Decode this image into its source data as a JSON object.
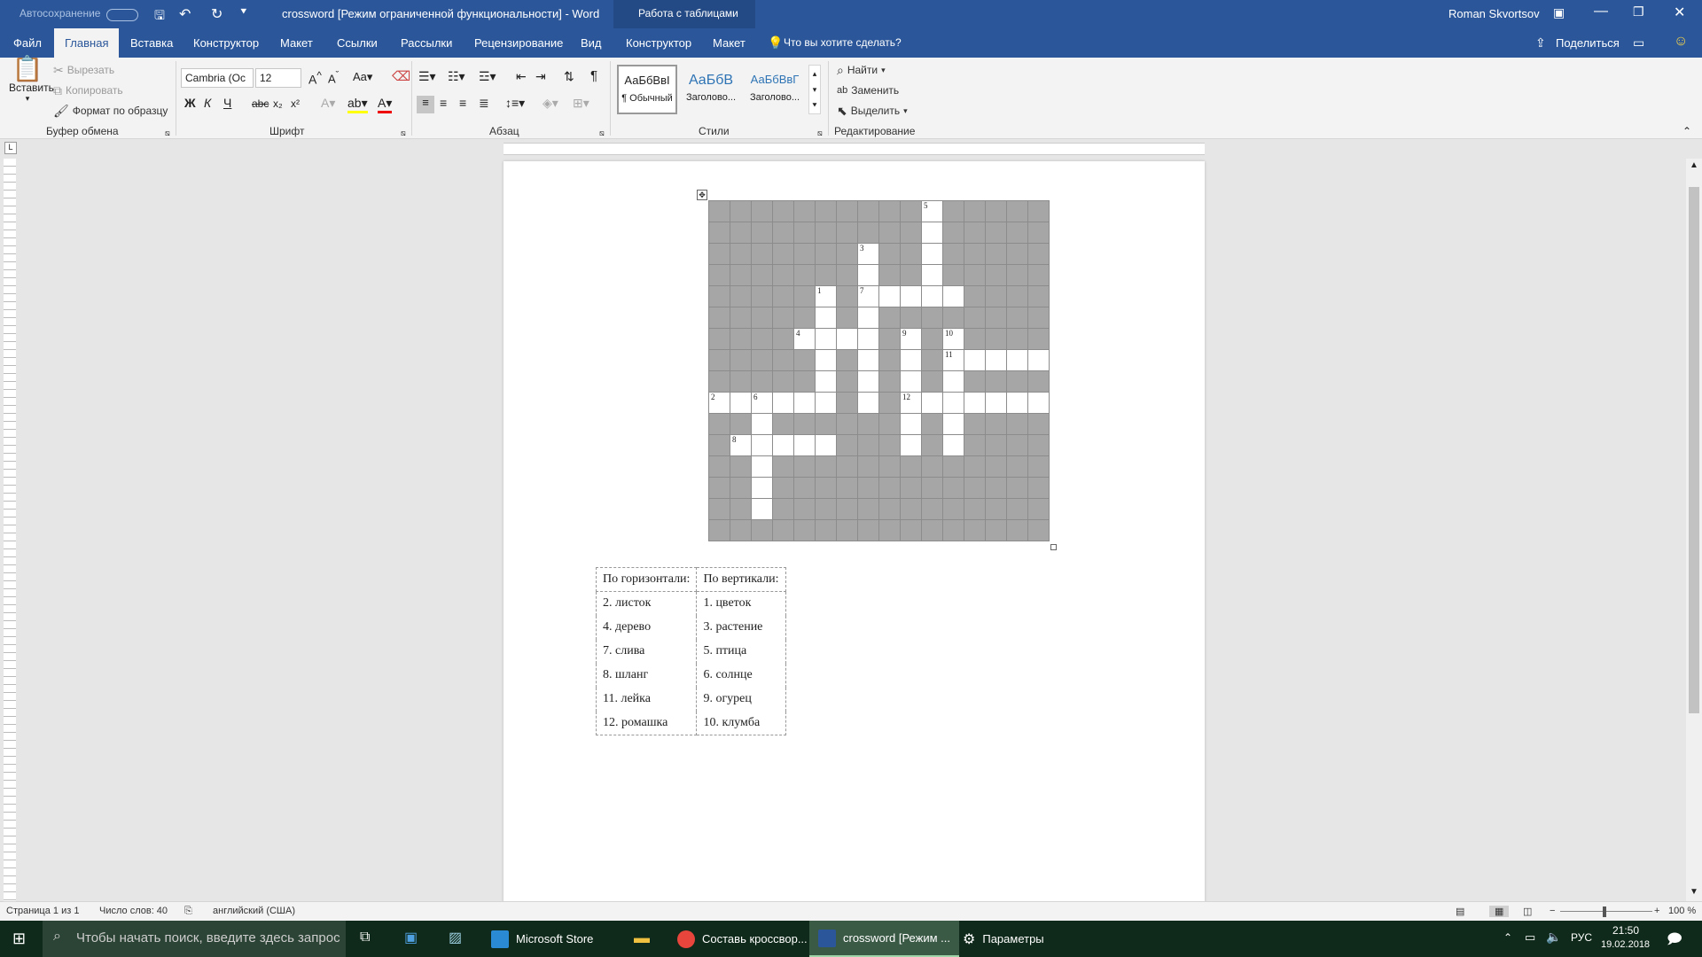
{
  "titlebar": {
    "autosave": "Автосохранение",
    "title": "crossword [Режим ограниченной функциональности]  -  Word",
    "context": "Работа с таблицами",
    "user": "Roman Skvortsov"
  },
  "tabs": [
    "Файл",
    "Главная",
    "Вставка",
    "Конструктор",
    "Макет",
    "Ссылки",
    "Рассылки",
    "Рецензирование",
    "Вид",
    "Конструктор",
    "Макет"
  ],
  "tell_me": "Что вы хотите сделать?",
  "share": "Поделиться",
  "ribbon": {
    "clipboard": {
      "paste": "Вставить",
      "cut": "Вырезать",
      "copy": "Копировать",
      "format_painter": "Формат по образцу",
      "label": "Буфер обмена"
    },
    "font": {
      "name": "Cambria (Ос",
      "size": "12",
      "label": "Шрифт",
      "bold": "Ж",
      "italic": "К",
      "underline": "Ч"
    },
    "paragraph": {
      "label": "Абзац"
    },
    "styles": {
      "label": "Стили",
      "items": [
        {
          "preview": "АаБбВвІ",
          "name": "¶ Обычный"
        },
        {
          "preview": "АаБбВ",
          "name": "Заголово..."
        },
        {
          "preview": "АаБбВвГ",
          "name": "Заголово..."
        }
      ]
    },
    "editing": {
      "find": "Найти",
      "replace": "Заменить",
      "select": "Выделить",
      "label": "Редактирование"
    }
  },
  "crossword": {
    "rows": [
      [
        "b",
        "b",
        "b",
        "b",
        "b",
        "b",
        "b",
        "b",
        "b",
        "b",
        "w:5",
        "b",
        "b",
        "b",
        "b",
        "b"
      ],
      [
        "b",
        "b",
        "b",
        "b",
        "b",
        "b",
        "b",
        "b",
        "b",
        "b",
        "w",
        "b",
        "b",
        "b",
        "b",
        "b"
      ],
      [
        "b",
        "b",
        "b",
        "b",
        "b",
        "b",
        "b",
        "w:3",
        "b",
        "b",
        "w",
        "b",
        "b",
        "b",
        "b",
        "b"
      ],
      [
        "b",
        "b",
        "b",
        "b",
        "b",
        "b",
        "b",
        "w",
        "b",
        "b",
        "w",
        "b",
        "b",
        "b",
        "b",
        "b"
      ],
      [
        "b",
        "b",
        "b",
        "b",
        "b",
        "w:1",
        "b",
        "w:7",
        "w",
        "w",
        "w",
        "w",
        "b",
        "b",
        "b",
        "b"
      ],
      [
        "b",
        "b",
        "b",
        "b",
        "b",
        "w",
        "b",
        "w",
        "b",
        "b",
        "b",
        "b",
        "b",
        "b",
        "b",
        "b"
      ],
      [
        "b",
        "b",
        "b",
        "b",
        "w:4",
        "w",
        "w",
        "w",
        "b",
        "w:9",
        "b",
        "w:10",
        "b",
        "b",
        "b",
        "b"
      ],
      [
        "b",
        "b",
        "b",
        "b",
        "b",
        "w",
        "b",
        "w",
        "b",
        "w",
        "b",
        "w:11",
        "w",
        "w",
        "w",
        "w"
      ],
      [
        "b",
        "b",
        "b",
        "b",
        "b",
        "w",
        "b",
        "w",
        "b",
        "w",
        "b",
        "w",
        "b",
        "b",
        "b",
        "b"
      ],
      [
        "w:2",
        "w",
        "w:6",
        "w",
        "w",
        "w",
        "b",
        "w",
        "b",
        "w:12",
        "w",
        "w",
        "w",
        "w",
        "w",
        "w"
      ],
      [
        "b",
        "b",
        "w",
        "b",
        "b",
        "b",
        "b",
        "b",
        "b",
        "w",
        "b",
        "w",
        "b",
        "b",
        "b",
        "b"
      ],
      [
        "b",
        "w:8",
        "w",
        "w",
        "w",
        "w",
        "b",
        "b",
        "b",
        "w",
        "b",
        "w",
        "b",
        "b",
        "b",
        "b"
      ],
      [
        "b",
        "b",
        "w",
        "b",
        "b",
        "b",
        "b",
        "b",
        "b",
        "b",
        "b",
        "b",
        "b",
        "b",
        "b",
        "b"
      ],
      [
        "b",
        "b",
        "w",
        "b",
        "b",
        "b",
        "b",
        "b",
        "b",
        "b",
        "b",
        "b",
        "b",
        "b",
        "b",
        "b"
      ],
      [
        "b",
        "b",
        "w",
        "b",
        "b",
        "b",
        "b",
        "b",
        "b",
        "b",
        "b",
        "b",
        "b",
        "b",
        "b",
        "b"
      ],
      [
        "b",
        "b",
        "b",
        "b",
        "b",
        "b",
        "b",
        "b",
        "b",
        "b",
        "b",
        "b",
        "b",
        "b",
        "b",
        "b"
      ]
    ]
  },
  "clues": {
    "across_header": "По горизонтали:",
    "down_header": "По вертикали:",
    "across": [
      "2. листок",
      "4. дерево",
      "7. слива",
      "8. шланг",
      "11. лейка",
      "12. ромашка"
    ],
    "down": [
      "1. цветок",
      "3. растение",
      "5. птица",
      "6. солнце",
      "9. огурец",
      "10. клумба"
    ]
  },
  "status": {
    "page": "Страница 1 из 1",
    "words": "Число слов: 40",
    "lang": "английский (США)",
    "zoom": "100 %"
  },
  "taskbar": {
    "search": "Чтобы начать поиск, введите здесь запрос",
    "apps": [
      {
        "label": "Microsoft Store"
      },
      {
        "label": "Составь кроссвор..."
      },
      {
        "label": "crossword [Режим ..."
      },
      {
        "label": "Параметры"
      }
    ],
    "lang": "РУС",
    "time": "21:50",
    "date": "19.02.2018"
  },
  "colors": {
    "word_blue": "#2b579a",
    "black_cell": "#a6a6a6"
  }
}
